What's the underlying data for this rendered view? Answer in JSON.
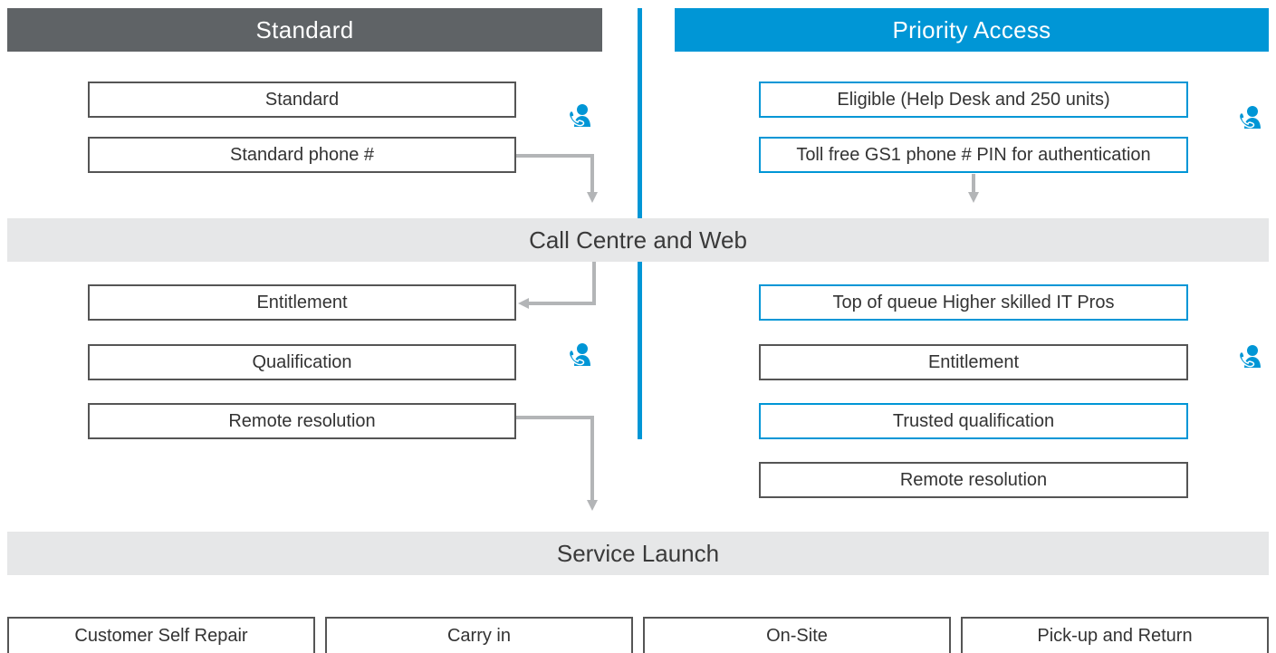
{
  "headers": {
    "standard": "Standard",
    "priority": "Priority Access"
  },
  "standard": {
    "top_boxes": [
      "Standard",
      "Standard phone #"
    ],
    "bottom_boxes": [
      "Entitlement",
      "Qualification",
      "Remote resolution"
    ]
  },
  "priority": {
    "top_boxes": [
      "Eligible (Help Desk and 250 units)",
      "Toll free GS1 phone # PIN for authentication"
    ],
    "bottom_boxes": [
      "Top of queue Higher skilled IT Pros",
      "Entitlement",
      "Trusted qualification",
      "Remote resolution"
    ]
  },
  "bands": {
    "call_centre": "Call Centre and Web",
    "service_launch": "Service Launch"
  },
  "service_options": [
    "Customer Self Repair",
    "Carry in",
    "On-Site",
    "Pick-up and Return"
  ],
  "colors": {
    "standard_header": "#5f6366",
    "priority_blue": "#0096d6",
    "band_grey": "#e6e7e8",
    "arrow_grey": "#b3b5b7"
  },
  "icons": {
    "support_agent": "support-agent-phone-icon"
  }
}
